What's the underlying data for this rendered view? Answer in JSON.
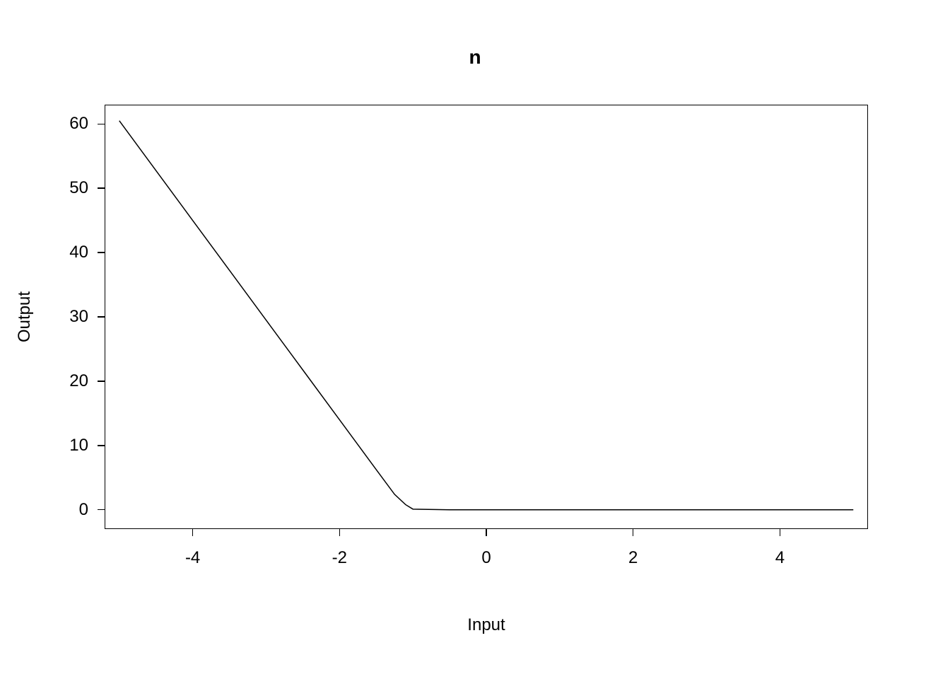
{
  "chart_data": {
    "type": "line",
    "title": "n",
    "xlabel": "Input",
    "ylabel": "Output",
    "xlim": [
      -5,
      5
    ],
    "ylim": [
      0,
      60
    ],
    "x_ticks": [
      -4,
      -2,
      0,
      2,
      4
    ],
    "y_ticks": [
      0,
      10,
      20,
      30,
      40,
      50,
      60
    ],
    "x_data_range": [
      -5.2,
      5.2
    ],
    "y_data_range": [
      -3,
      63
    ],
    "series": [
      {
        "name": "n",
        "x": [
          -5,
          -4.5,
          -4,
          -3.5,
          -3,
          -2.5,
          -2,
          -1.5,
          -1.25,
          -1.1,
          -1,
          -0.5,
          0,
          1,
          2,
          3,
          4,
          5
        ],
        "y": [
          60.5,
          52.75,
          45,
          37.25,
          29.5,
          21.75,
          14,
          6.25,
          2.4,
          0.8,
          0.1,
          0,
          0,
          0,
          0,
          0,
          0,
          0
        ]
      }
    ]
  }
}
